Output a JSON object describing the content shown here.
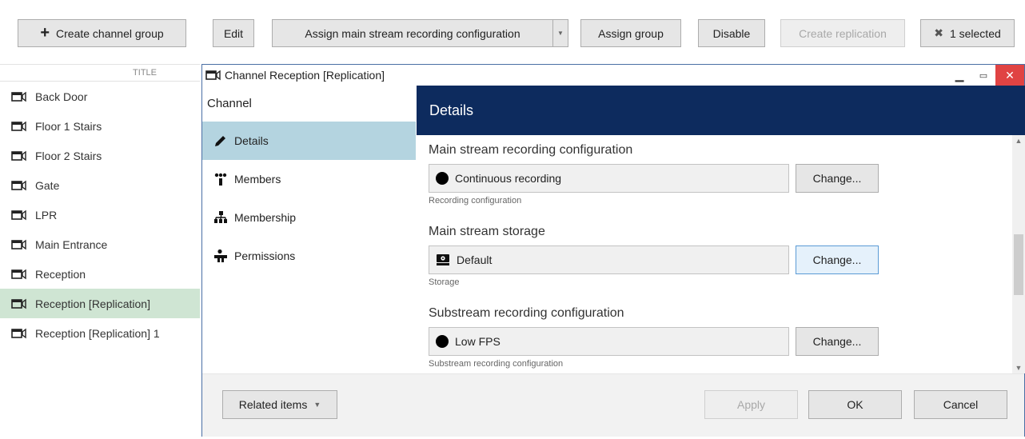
{
  "toolbar": {
    "create_group": "Create channel group",
    "edit": "Edit",
    "assign_main": "Assign main stream recording configuration",
    "assign_group": "Assign group",
    "disable": "Disable",
    "create_replication": "Create replication",
    "selected": "1 selected"
  },
  "list": {
    "header": "TITLE",
    "items": [
      "Back Door",
      "Floor 1 Stairs",
      "Floor 2 Stairs",
      "Gate",
      "LPR",
      "Main Entrance",
      "Reception",
      "Reception [Replication]",
      "Reception [Replication] 1"
    ],
    "selected_index": 7
  },
  "dialog": {
    "title": "Channel Reception [Replication]",
    "nav_header": "Channel",
    "nav": [
      "Details",
      "Members",
      "Membership",
      "Permissions"
    ],
    "active_nav": 0,
    "content_title": "Details",
    "sections": [
      {
        "label": "Main stream recording configuration",
        "value": "Continuous recording",
        "hint": "Recording configuration",
        "change": "Change..."
      },
      {
        "label": "Main stream storage",
        "value": "Default",
        "hint": "Storage",
        "change": "Change..."
      },
      {
        "label": "Substream recording configuration",
        "value": "Low FPS",
        "hint": "Substream recording configuration",
        "change": "Change..."
      }
    ],
    "footer": {
      "related": "Related items",
      "apply": "Apply",
      "ok": "OK",
      "cancel": "Cancel"
    }
  },
  "colors": {
    "header_bg": "#0d2b5e",
    "nav_active": "#b4d4e0",
    "list_selected": "#cfe5d3",
    "close_btn": "#e04343"
  }
}
